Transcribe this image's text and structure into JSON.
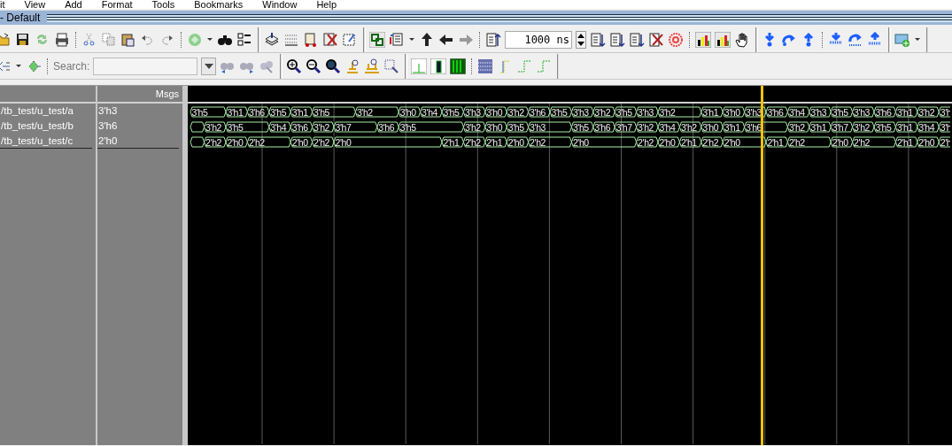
{
  "menu": [
    {
      "label": "it"
    },
    {
      "label": "View"
    },
    {
      "label": "Add"
    },
    {
      "label": "Format"
    },
    {
      "label": "Tools"
    },
    {
      "label": "Bookmarks"
    },
    {
      "label": "Window"
    },
    {
      "label": "Help"
    }
  ],
  "window": {
    "title": "- Default"
  },
  "toolbar": {
    "time_field": {
      "value": "1000 ns"
    },
    "search": {
      "label": "Search:"
    }
  },
  "wave": {
    "header": {
      "msgs": "Msgs"
    },
    "signals": [
      {
        "name": "/tb_test/u_test/a",
        "value": "3'h3",
        "segments": [
          {
            "value": "3'h5",
            "kind": "lead"
          },
          {
            "value": "3'h1",
            "kind": "one"
          },
          {
            "value": "3'h6",
            "kind": "one"
          },
          {
            "value": "3'h5",
            "kind": "one"
          },
          {
            "value": "3'h1",
            "kind": "one"
          },
          {
            "value": "3'h5",
            "kind": "two"
          },
          {
            "value": "3'h2",
            "kind": "two"
          },
          {
            "value": "3'h0",
            "kind": "one"
          },
          {
            "value": "3'h4",
            "kind": "one"
          },
          {
            "value": "3'h5",
            "kind": "one"
          },
          {
            "value": "3'h3",
            "kind": "one"
          },
          {
            "value": "3'h0",
            "kind": "one"
          },
          {
            "value": "3'h2",
            "kind": "one"
          },
          {
            "value": "3'h6",
            "kind": "one"
          },
          {
            "value": "3'h5",
            "kind": "one"
          },
          {
            "value": "3'h3",
            "kind": "one"
          },
          {
            "value": "3'h2",
            "kind": "one"
          },
          {
            "value": "3'h5",
            "kind": "one"
          },
          {
            "value": "3'h3",
            "kind": "one"
          },
          {
            "value": "3'h2",
            "kind": "two"
          },
          {
            "value": "3'h1",
            "kind": "one"
          },
          {
            "value": "3'h0",
            "kind": "one"
          },
          {
            "value": "3'h3",
            "kind": "one"
          },
          {
            "value": "3'h6",
            "kind": "one"
          },
          {
            "value": "3'h4",
            "kind": "one"
          },
          {
            "value": "3'h3",
            "kind": "one"
          },
          {
            "value": "3'h5",
            "kind": "one"
          },
          {
            "value": "3'h3",
            "kind": "one"
          },
          {
            "value": "3'h6",
            "kind": "one"
          },
          {
            "value": "3'h1",
            "kind": "one"
          },
          {
            "value": "3'h2",
            "kind": "one"
          },
          {
            "value": "3'h",
            "kind": "tail"
          }
        ]
      },
      {
        "name": "/tb_test/u_test/b",
        "value": "3'h6",
        "segments": [
          {
            "kind": "stub"
          },
          {
            "value": "3'h2",
            "kind": "one"
          },
          {
            "value": "3'h5",
            "kind": "two"
          },
          {
            "value": "3'h4",
            "kind": "one"
          },
          {
            "value": "3'h6",
            "kind": "one"
          },
          {
            "value": "3'h2",
            "kind": "one"
          },
          {
            "value": "3'h7",
            "kind": "two"
          },
          {
            "value": "3'h6",
            "kind": "one"
          },
          {
            "value": "3'h5",
            "kind": "three"
          },
          {
            "value": "3'h2",
            "kind": "one"
          },
          {
            "value": "3'h0",
            "kind": "one"
          },
          {
            "value": "3'h5",
            "kind": "one"
          },
          {
            "value": "3'h3",
            "kind": "two"
          },
          {
            "value": "3'h5",
            "kind": "one"
          },
          {
            "value": "3'h6",
            "kind": "one"
          },
          {
            "value": "3'h7",
            "kind": "one"
          },
          {
            "value": "3'h2",
            "kind": "one"
          },
          {
            "value": "3'h4",
            "kind": "one"
          },
          {
            "value": "3'h2",
            "kind": "one"
          },
          {
            "value": "3'h0",
            "kind": "one"
          },
          {
            "value": "3'h1",
            "kind": "one"
          },
          {
            "value": "3'h6",
            "kind": "two"
          },
          {
            "value": "3'h2",
            "kind": "one"
          },
          {
            "value": "3'h1",
            "kind": "one"
          },
          {
            "value": "3'h7",
            "kind": "one"
          },
          {
            "value": "3'h2",
            "kind": "one"
          },
          {
            "value": "3'h5",
            "kind": "one"
          },
          {
            "value": "3'h1",
            "kind": "one"
          },
          {
            "value": "3'h4",
            "kind": "one"
          },
          {
            "value": "3'h",
            "kind": "tail"
          }
        ]
      },
      {
        "name": "/tb_test/u_test/c",
        "value": "2'h0",
        "segments": [
          {
            "kind": "stub"
          },
          {
            "value": "2'h2",
            "kind": "one"
          },
          {
            "value": "2'h0",
            "kind": "one"
          },
          {
            "value": "2'h2",
            "kind": "two"
          },
          {
            "value": "2'h0",
            "kind": "one"
          },
          {
            "value": "2'h2",
            "kind": "one"
          },
          {
            "value": "2'h0",
            "kind": "five"
          },
          {
            "value": "2'h1",
            "kind": "one"
          },
          {
            "value": "2'h2",
            "kind": "one"
          },
          {
            "value": "2'h1",
            "kind": "one"
          },
          {
            "value": "2'h0",
            "kind": "one"
          },
          {
            "value": "2'h2",
            "kind": "two"
          },
          {
            "value": "2'h0",
            "kind": "three"
          },
          {
            "value": "2'h2",
            "kind": "one"
          },
          {
            "value": "2'h0",
            "kind": "one"
          },
          {
            "value": "2'h1",
            "kind": "one"
          },
          {
            "value": "2'h2",
            "kind": "one"
          },
          {
            "value": "2'h0",
            "kind": "two"
          },
          {
            "value": "2'h1",
            "kind": "one"
          },
          {
            "value": "2'h2",
            "kind": "two"
          },
          {
            "value": "2'h0",
            "kind": "one"
          },
          {
            "value": "2'h2",
            "kind": "two"
          },
          {
            "value": "2'h1",
            "kind": "one"
          },
          {
            "value": "2'h0",
            "kind": "one"
          },
          {
            "value": "2'h",
            "kind": "tail"
          }
        ]
      }
    ]
  }
}
